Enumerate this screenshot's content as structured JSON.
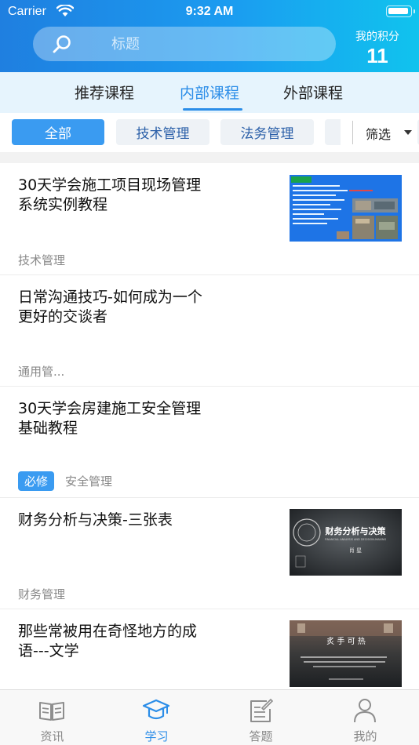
{
  "status_bar": {
    "carrier": "Carrier",
    "time": "9:32 AM"
  },
  "header": {
    "search_placeholder": "标题",
    "points_label": "我的积分",
    "points_value": "11"
  },
  "tabs": [
    {
      "label": "推荐课程",
      "active": false
    },
    {
      "label": "内部课程",
      "active": true
    },
    {
      "label": "外部课程",
      "active": false
    }
  ],
  "filters": {
    "chips": [
      {
        "label": "全部",
        "active": true
      },
      {
        "label": "技术管理",
        "active": false
      },
      {
        "label": "法务管理",
        "active": false
      }
    ],
    "filter_label": "筛选"
  },
  "courses": [
    {
      "title_line1": "30天学会施工项目现场管理",
      "title_line2": "系统实例教程",
      "category": "技术管理",
      "badge": "",
      "thumbnail": "blue-slide"
    },
    {
      "title_line1": "日常沟通技巧-如何成为一个",
      "title_line2": "更好的交谈者",
      "category": "通用管...",
      "badge": "",
      "thumbnail": ""
    },
    {
      "title_line1": "30天学会房建施工安全管理",
      "title_line2": "基础教程",
      "category": "安全管理",
      "badge": "必修",
      "thumbnail": ""
    },
    {
      "title_line1": "财务分析与决策-三张表",
      "title_line2": "",
      "category": "财务管理",
      "badge": "",
      "thumbnail": "dark-emblem"
    },
    {
      "title_line1": "那些常被用在奇怪地方的成",
      "title_line2": "语---文学",
      "category": "",
      "badge": "",
      "thumbnail": "dark-scene"
    }
  ],
  "thumb_text": {
    "finance_title": "财务分析与决策",
    "finance_sub": "FINANCIAL ANALYSIS AND DECISION-MAKING",
    "finance_name": "肖 星",
    "idiom_title": "炙 手 可 热"
  },
  "tabbar": [
    {
      "label": "资讯",
      "icon": "book-icon",
      "active": false
    },
    {
      "label": "学习",
      "icon": "graduation-cap-icon",
      "active": true
    },
    {
      "label": "答题",
      "icon": "edit-paper-icon",
      "active": false
    },
    {
      "label": "我的",
      "icon": "person-icon",
      "active": false
    }
  ],
  "colors": {
    "primary": "#2b8de8",
    "header_start": "#1f7fe0",
    "header_end": "#10c3ee",
    "badge": "#3a9bf1"
  }
}
